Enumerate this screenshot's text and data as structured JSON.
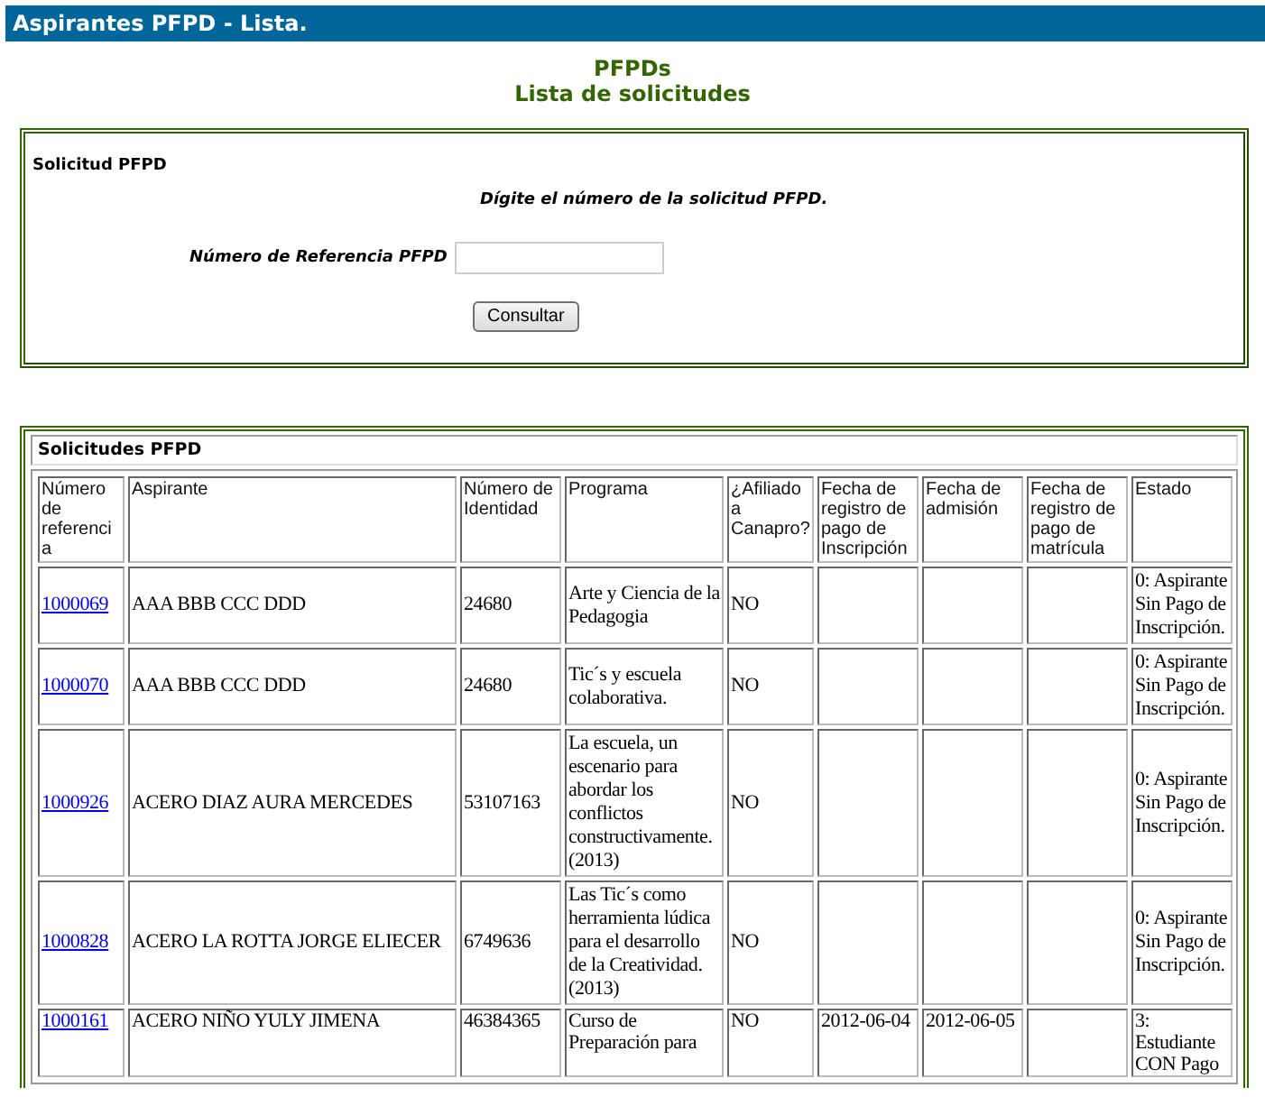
{
  "header": {
    "title": "Aspirantes PFPD - Lista."
  },
  "headings": [
    "PFPDs",
    "Lista de solicitudes"
  ],
  "search_form": {
    "title": "Solicitud PFPD",
    "instruction": "Dígite el número de la solicitud PFPD.",
    "field_label": "Número de Referencia PFPD",
    "button": "Consultar"
  },
  "table": {
    "title": "Solicitudes PFPD",
    "columns": [
      "Número de referencia",
      "Aspirante",
      "Número de Identidad",
      "Programa",
      "¿Afiliado a Canapro?",
      "Fecha de registro de pago de Inscripción",
      "Fecha de admisión",
      "Fecha de registro de pago de matrícula",
      "Estado"
    ],
    "rows": [
      {
        "cells": [
          "1000069",
          "AAA BBB CCC DDD",
          "24680",
          "Arte y Ciencia de la Pedagogia",
          "NO",
          "",
          "",
          "",
          "0: Aspirante Sin Pago de Inscripción."
        ]
      },
      {
        "cells": [
          "1000070",
          "AAA BBB CCC DDD",
          "24680",
          "Tic´s y escuela colaborativa.",
          "NO",
          "",
          "",
          "",
          "0: Aspirante Sin Pago de Inscripción."
        ]
      },
      {
        "cells": [
          "1000926",
          "ACERO DIAZ AURA MERCEDES",
          "53107163",
          "La escuela, un escenario para abordar los conflictos constructivamente. (2013)",
          "NO",
          "",
          "",
          "",
          "0: Aspirante Sin Pago de Inscripción."
        ]
      },
      {
        "cells": [
          "1000828",
          "ACERO LA ROTTA JORGE ELIECER",
          "6749636",
          "Las Tic´s como herramienta lúdica para el desarrollo de la Creatividad. (2013)",
          "NO",
          "",
          "",
          "",
          "0: Aspirante Sin Pago de Inscripción."
        ]
      },
      {
        "cells": [
          "1000161",
          "ACERO NIÑO YULY JIMENA",
          "46384365",
          "Curso de Preparación para",
          "NO",
          "2012-06-04",
          "2012-06-05",
          "",
          "3: Estudiante CON Pago"
        ]
      }
    ]
  }
}
